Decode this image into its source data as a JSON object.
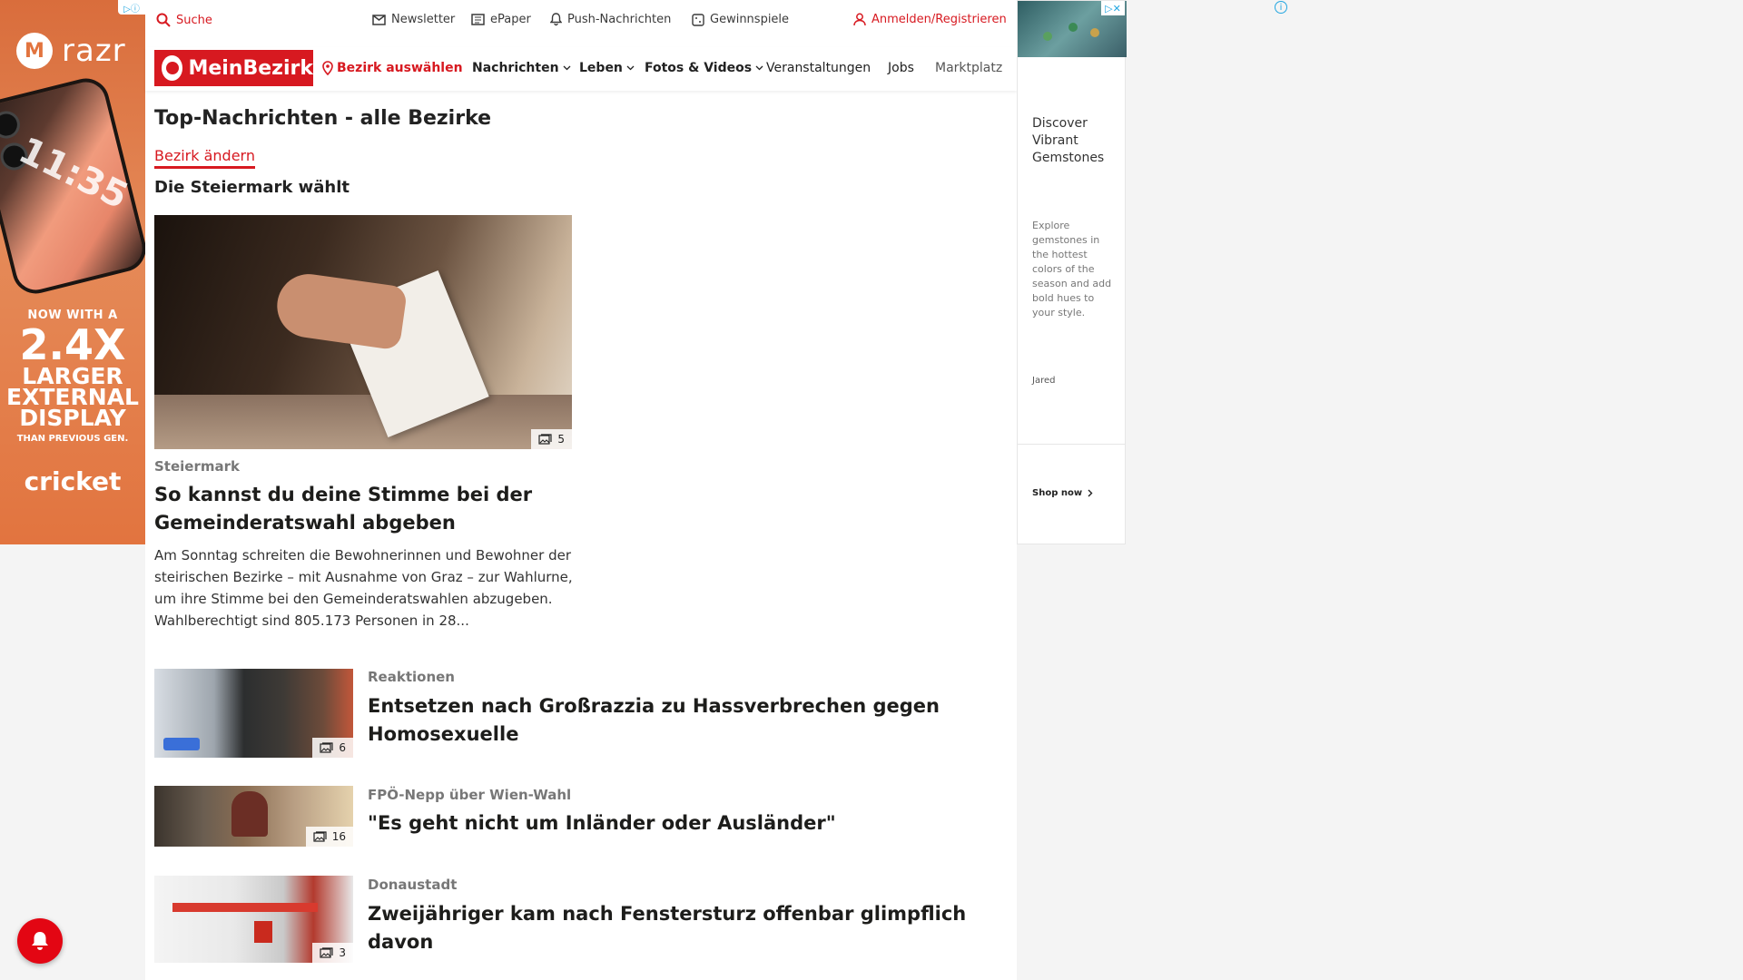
{
  "ad_left": {
    "adchoices_label": "▷ⓘ",
    "brand": "razr",
    "line1": "NOW WITH A",
    "line2": "2.4X",
    "line3a": "LARGER",
    "line3b": "EXTERNAL",
    "line3c": "DISPLAY",
    "line4": "THAN PREVIOUS GEN.",
    "carrier": "cricket",
    "phone_time": "11:35"
  },
  "topbar": {
    "search": "Suche",
    "newsletter": "Newsletter",
    "epaper": "ePaper",
    "push": "Push-Nachrichten",
    "gewinnspiele": "Gewinnspiele",
    "login": "Anmelden/Registrieren"
  },
  "nav": {
    "logo": "MeinBezirk",
    "district": "Bezirk auswählen",
    "items": [
      "Nachrichten",
      "Leben",
      "Fotos & Videos",
      "Veranstaltungen",
      "Jobs",
      "Marktplatz"
    ]
  },
  "page": {
    "title": "Top-Nachrichten - alle Bezirke",
    "change_link": "Bezirk ändern",
    "section": "Die Steiermark wählt"
  },
  "hero": {
    "category": "Steiermark",
    "title": "So kannst du deine Stimme bei der Gemeinderatswahl abgeben",
    "teaser": "Am Sonntag schreiten die Bewohnerinnen und Bewohner der steirischen Bezirke – mit Ausnahme von Graz – zur Wahlurne, um ihre Stimme bei den Gemeinderatswahlen abzugeben. Wahlberechtigt sind 805.173 Personen in 28...",
    "image_count": "5"
  },
  "articles": [
    {
      "category": "Reaktionen",
      "title": "Entsetzen nach Großrazzia zu Hassverbrechen gegen Homosexuelle",
      "image_count": "6"
    },
    {
      "category": "FPÖ-Nepp über Wien-Wahl",
      "title": "\"Es geht nicht um Inländer oder Ausländer\"",
      "image_count": "16"
    },
    {
      "category": "Donaustadt",
      "title": "Zweijähriger kam nach Fenstersturz offenbar glimpflich davon",
      "image_count": "3"
    }
  ],
  "ad_right": {
    "headline": "Discover Vibrant Gemstones",
    "description": "Explore gemstones in the hottest colors of the season and add bold hues to your style.",
    "advertiser": "Jared",
    "cta": "Shop now"
  },
  "colors": {
    "brand_red": "#d71920",
    "ad_orange": "#e2743f"
  }
}
